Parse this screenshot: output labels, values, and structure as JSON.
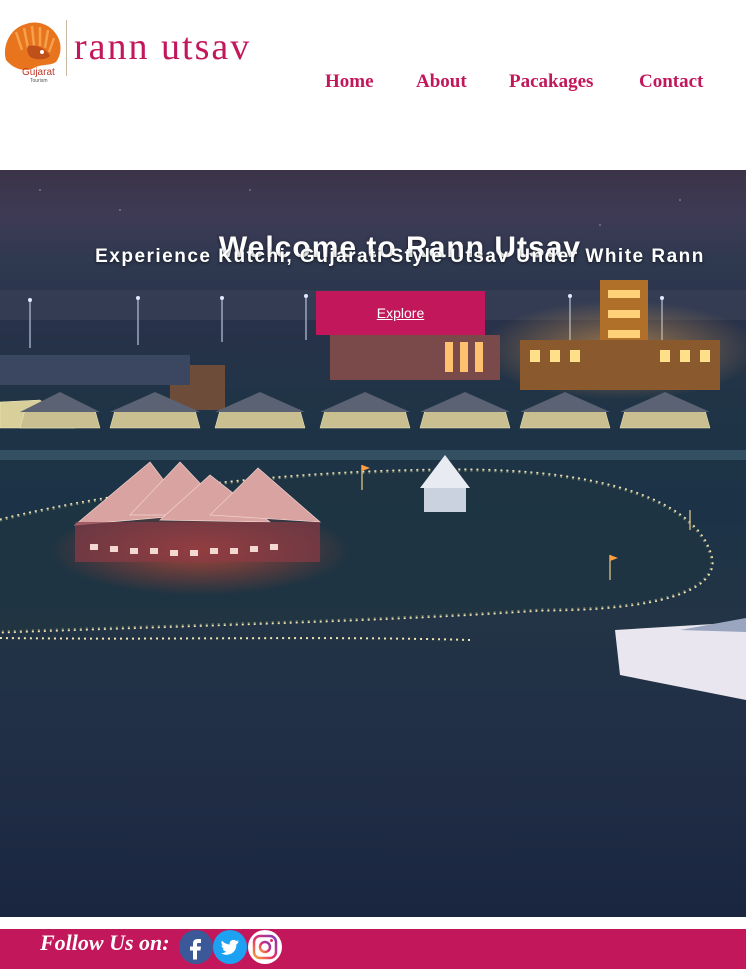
{
  "brand": {
    "title": "rann utsav",
    "logo_text": "Gujarat",
    "logo_subtext": "Tourism",
    "accent_color": "#c2185b"
  },
  "nav": {
    "items": [
      {
        "label": "Home"
      },
      {
        "label": "About"
      },
      {
        "label": "Pacakages"
      },
      {
        "label": "Contact"
      }
    ]
  },
  "hero": {
    "title": "Welcome to Rann Utsav",
    "subtitle": "Experience Kutchi, Gujarati Style Utsav Under White Rann",
    "button_label": "Explore",
    "background": "night-tent-city-photo"
  },
  "footer": {
    "follow_label": "Follow Us on:",
    "social": [
      {
        "icon": "facebook-icon"
      },
      {
        "icon": "twitter-icon"
      },
      {
        "icon": "instagram-icon"
      }
    ]
  }
}
